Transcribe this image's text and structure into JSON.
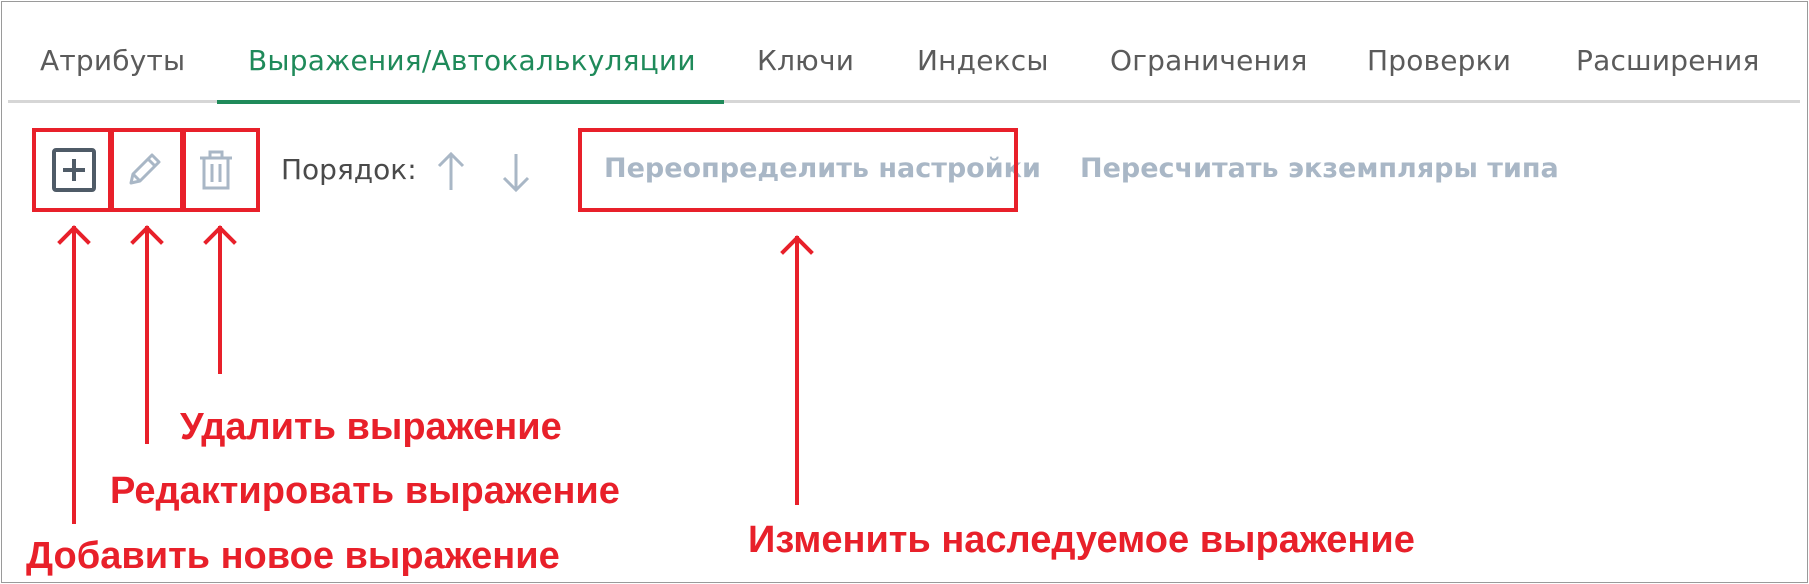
{
  "tabs": [
    {
      "label": "Атрибуты",
      "active": false
    },
    {
      "label": "Выражения/Автокалькуляции",
      "active": true
    },
    {
      "label": "Ключи",
      "active": false
    },
    {
      "label": "Индексы",
      "active": false
    },
    {
      "label": "Ограничения",
      "active": false
    },
    {
      "label": "Проверки",
      "active": false
    },
    {
      "label": "Расширения",
      "active": false
    }
  ],
  "toolbar": {
    "icons": [
      "plus-box-icon",
      "pencil-icon",
      "trash-icon"
    ],
    "order_label": "Порядок:",
    "order_icons": [
      "arrow-up-icon",
      "arrow-down-icon"
    ],
    "override_settings": "Переопределить настройки",
    "recalculate_instances": "Пересчитать экземпляры типа"
  },
  "annotations": {
    "add": "Добавить новое выражение",
    "edit": "Редактировать выражение",
    "delete": "Удалить выражение",
    "override": "Изменить наследуемое выражение"
  },
  "colors": {
    "accent_green": "#1f8a5a",
    "annotation_red": "#e8202a",
    "disabled_icon": "#a9b7c6",
    "active_icon": "#4f5b67"
  }
}
